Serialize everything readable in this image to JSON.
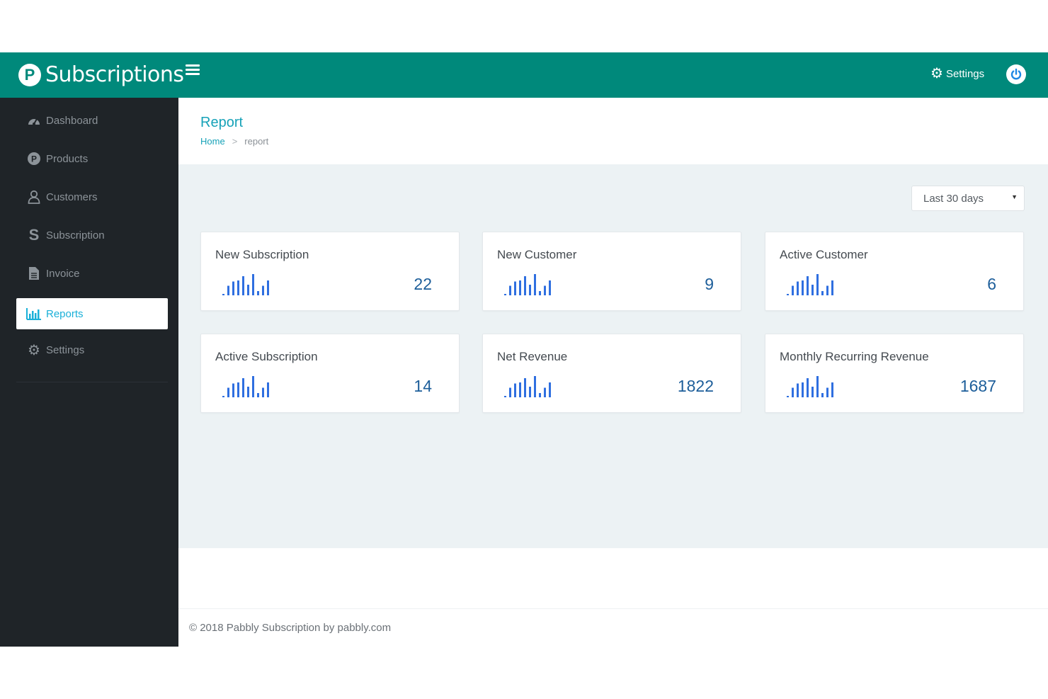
{
  "brand": {
    "logo_letter": "P",
    "name": "Subscriptions",
    "color": "#00897b"
  },
  "topbar": {
    "settings_label": "Settings",
    "menu_icon": "hamburger-icon",
    "settings_icon": "gear-icon",
    "power_icon": "power-icon"
  },
  "sidebar": {
    "items": [
      {
        "label": "Dashboard",
        "icon": "dashboard-icon",
        "active": false
      },
      {
        "label": "Products",
        "icon": "product-p-icon",
        "active": false
      },
      {
        "label": "Customers",
        "icon": "user-icon",
        "active": false
      },
      {
        "label": "Subscription",
        "icon": "subscription-s-icon",
        "active": false
      },
      {
        "label": "Invoice",
        "icon": "document-icon",
        "active": false
      },
      {
        "label": "Reports",
        "icon": "bar-chart-icon",
        "active": true
      },
      {
        "label": "Settings",
        "icon": "gear-icon",
        "active": false
      }
    ]
  },
  "header": {
    "title": "Report",
    "breadcrumb": {
      "home": "Home",
      "separator": ">",
      "current": "report"
    }
  },
  "filters": {
    "range": {
      "selected": "Last 30 days"
    }
  },
  "cards": [
    {
      "title": "New Subscription",
      "value": "22"
    },
    {
      "title": "New Customer",
      "value": "9"
    },
    {
      "title": "Active Customer",
      "value": "6"
    },
    {
      "title": "Active Subscription",
      "value": "14"
    },
    {
      "title": "Net Revenue",
      "value": "1822"
    },
    {
      "title": "Monthly Recurring Revenue",
      "value": "1687"
    }
  ],
  "sparkline": {
    "color": "#2f6fe0",
    "bar_levels": [
      0.06,
      0.45,
      0.65,
      0.7,
      0.9,
      0.5,
      1.0,
      0.2,
      0.45,
      0.7
    ]
  },
  "footer": {
    "copyright": "© 2018 Pabbly Subscription by pabbly.com"
  },
  "colors": {
    "accent": "#17a2b8",
    "sidebar_bg": "#1f2428",
    "content_bg": "#ecf2f4",
    "value_text": "#1d5e9a"
  }
}
